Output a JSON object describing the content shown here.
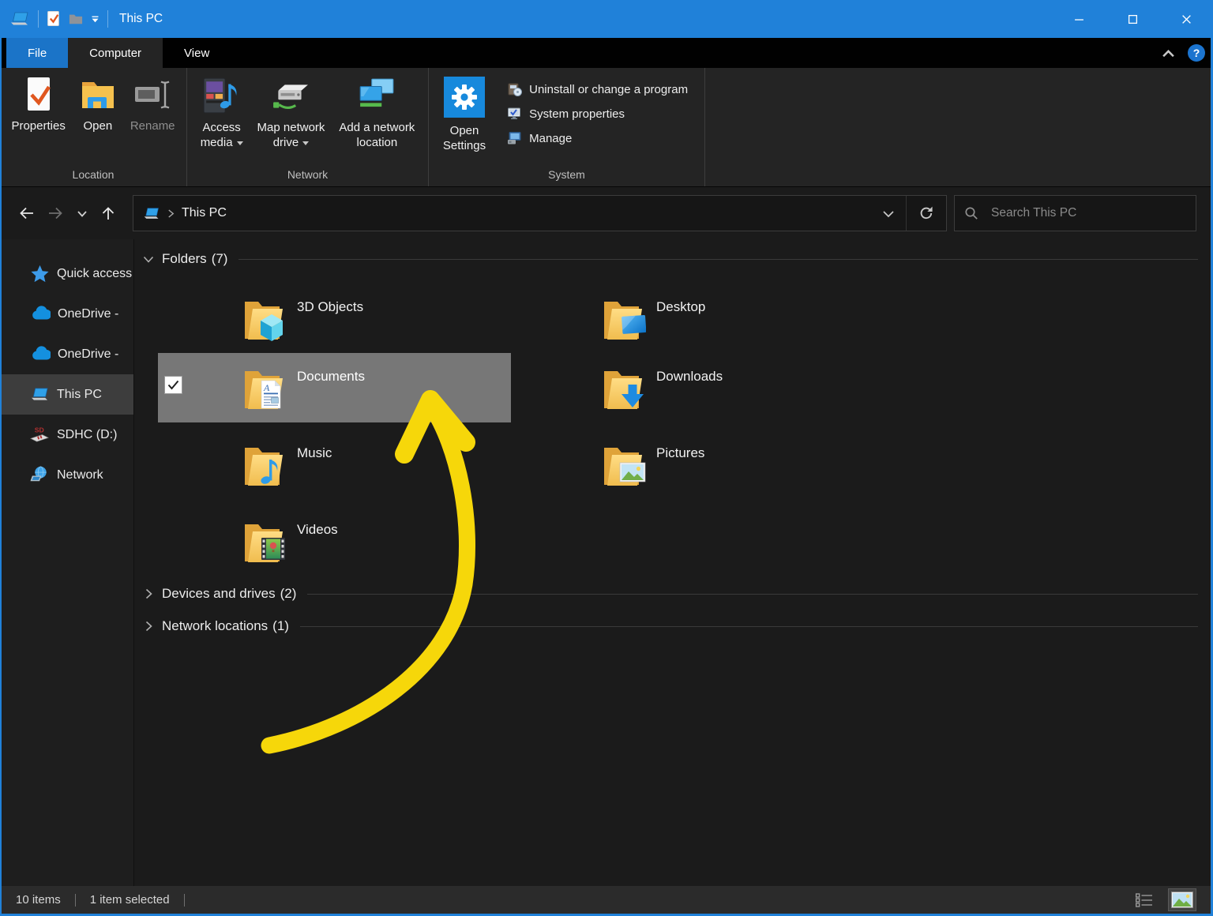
{
  "window": {
    "title": "This PC"
  },
  "tabs": {
    "file": "File",
    "computer": "Computer",
    "view": "View"
  },
  "ribbon": {
    "location": {
      "label": "Location",
      "properties": "Properties",
      "open": "Open",
      "rename": "Rename"
    },
    "network": {
      "label": "Network",
      "access_media_l1": "Access",
      "access_media_l2": "media",
      "map_drive_l1": "Map network",
      "map_drive_l2": "drive",
      "add_location_l1": "Add a network",
      "add_location_l2": "location"
    },
    "system": {
      "label": "System",
      "open_settings_l1": "Open",
      "open_settings_l2": "Settings",
      "uninstall": "Uninstall or change a program",
      "properties": "System properties",
      "manage": "Manage"
    }
  },
  "navbar": {
    "breadcrumb": "This PC",
    "search_placeholder": "Search This PC"
  },
  "sidebar": {
    "items": [
      {
        "label": "Quick access"
      },
      {
        "label": "OneDrive -"
      },
      {
        "label": "OneDrive -"
      },
      {
        "label": "This PC"
      },
      {
        "label": "SDHC (D:)"
      },
      {
        "label": "Network"
      }
    ]
  },
  "content": {
    "folders": {
      "label": "Folders",
      "count": "(7)",
      "items": [
        {
          "name": "3D Objects"
        },
        {
          "name": "Desktop"
        },
        {
          "name": "Documents"
        },
        {
          "name": "Downloads"
        },
        {
          "name": "Music"
        },
        {
          "name": "Pictures"
        },
        {
          "name": "Videos"
        }
      ]
    },
    "devices": {
      "label": "Devices and drives",
      "count": "(2)"
    },
    "network_locations": {
      "label": "Network locations",
      "count": "(1)"
    }
  },
  "statusbar": {
    "count": "10 items",
    "selected": "1 item selected"
  },
  "icons": {
    "help": "?",
    "documents_letter": "A",
    "sd_label": "SD"
  },
  "colors": {
    "titlebar_blue": "#2081D9",
    "file_tab_blue": "#1B74C8",
    "accent_blue": "#1789DC",
    "ribbon_bg": "#242424",
    "content_bg": "#1B1B1B",
    "tile_selection": "#777777",
    "sidebar_selection": "#3D3D3D",
    "folder_yellow": "#F2BE4E",
    "arrow_yellow": "#F6D70A"
  }
}
